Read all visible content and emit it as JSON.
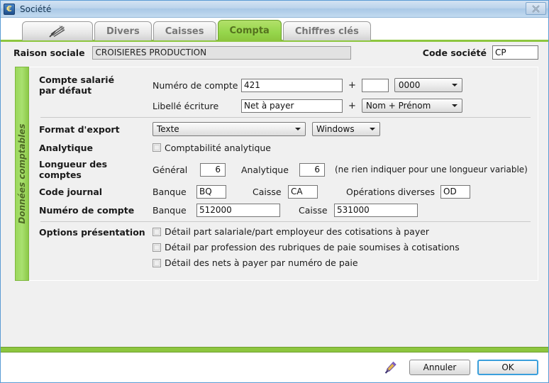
{
  "window": {
    "title": "Société",
    "app_icon": "euro-icon",
    "close_label": "✕"
  },
  "tabs": [
    {
      "label": "",
      "icon": "logo-icon",
      "active": false
    },
    {
      "label": "Divers",
      "active": false
    },
    {
      "label": "Caisses",
      "active": false
    },
    {
      "label": "Compta",
      "active": true
    },
    {
      "label": "Chiffres clés",
      "active": false
    }
  ],
  "header": {
    "raison_sociale_label": "Raison sociale",
    "raison_sociale_value": "CROISIERES PRODUCTION",
    "code_societe_label": "Code société",
    "code_societe_value": "CP"
  },
  "sidebar": {
    "label": "Données comptables"
  },
  "form": {
    "compte_salarie": {
      "group_label_line1": "Compte salarié",
      "group_label_line2": "par défaut",
      "numero_label": "Numéro de compte",
      "numero_value": "421",
      "plus": "+",
      "suffix_value": "",
      "format_select_value": "0000",
      "libelle_label": "Libellé écriture",
      "libelle_value": "Net à payer",
      "libelle_select_value": "Nom + Prénom"
    },
    "format_export": {
      "label": "Format d'export",
      "value": "Texte",
      "encoding_value": "Windows"
    },
    "analytique": {
      "label": "Analytique",
      "checkbox_label": "Comptabilité analytique",
      "checked": false
    },
    "longueur": {
      "label": "Longueur des comptes",
      "general_label": "Général",
      "general_value": "6",
      "analytique_label": "Analytique",
      "analytique_value": "6",
      "hint": "(ne rien indiquer pour une longueur variable)"
    },
    "code_journal": {
      "label": "Code journal",
      "banque_label": "Banque",
      "banque_value": "BQ",
      "caisse_label": "Caisse",
      "caisse_value": "CA",
      "od_label": "Opérations diverses",
      "od_value": "OD"
    },
    "numero_compte": {
      "label": "Numéro de compte",
      "banque_label": "Banque",
      "banque_value": "512000",
      "caisse_label": "Caisse",
      "caisse_value": "531000"
    },
    "options_presentation": {
      "label": "Options présentation",
      "items": [
        {
          "label": "Détail part salariale/part employeur des cotisations à payer",
          "checked": false
        },
        {
          "label": "Détail par profession des rubriques de paie soumises à cotisations",
          "checked": false
        },
        {
          "label": "Détail des nets à payer par numéro de paie",
          "checked": false
        }
      ]
    }
  },
  "footer": {
    "edit_icon": "pencil-icon",
    "cancel_label": "Annuler",
    "ok_label": "OK"
  },
  "colors": {
    "accent_green": "#8dc63f",
    "title_blue": "#a9c8e6",
    "default_button_border": "#3a9fdc"
  }
}
